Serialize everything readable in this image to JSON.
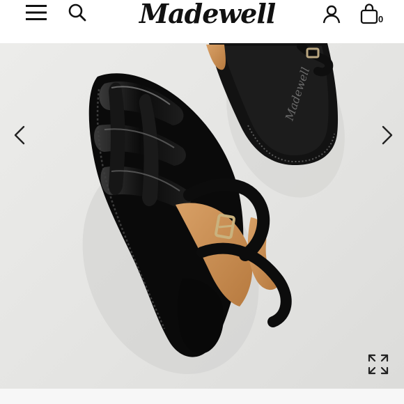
{
  "header": {
    "brand": "Madewell",
    "bag_count": "0",
    "icons": {
      "menu": "hamburger-menu-icon",
      "search": "search-icon",
      "account": "account-icon",
      "bag": "shopping-bag-icon"
    }
  },
  "gallery": {
    "background_color": "#e6e6e4",
    "product_color": "#0d0d0d",
    "lining_color": "#c98f52",
    "icons": {
      "prev": "chevron-left-icon",
      "next": "chevron-right-icon",
      "expand": "expand-icon"
    }
  }
}
